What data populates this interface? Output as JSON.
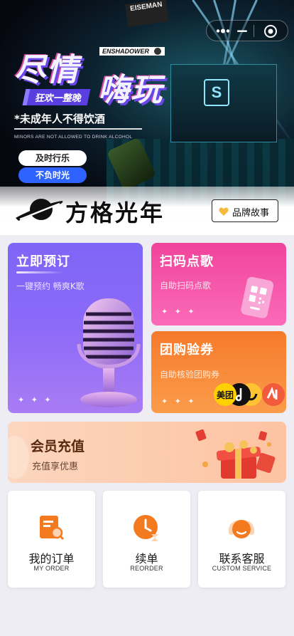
{
  "hero": {
    "title_line1": "尽情",
    "title_line2": "嗨玩",
    "brand_strip": "ENSHADOWER",
    "corner_tag": "EISEMAN",
    "tagline": "狂欢一整晚",
    "warning": "*未成年人不得饮酒",
    "warning_en": "MINORS ARE NOT ALLOWED TO DRINK ALCOHOL",
    "pill_1": "及时行乐",
    "pill_2": "不负时光"
  },
  "brand": {
    "name": "方格光年",
    "story_button": "品牌故事"
  },
  "cards": {
    "book": {
      "title": "立即预订",
      "subtitle": "一键预约 畅爽K歌",
      "sparks": "✦ ✦ ✦"
    },
    "scan": {
      "title": "扫码点歌",
      "subtitle": "自助扫码点歌",
      "sparks": "✦ ✦ ✦"
    },
    "group": {
      "title": "团购验券",
      "subtitle": "自助核验团购券",
      "sparks": "✦ ✦ ✦",
      "logo_text": "美团"
    },
    "member": {
      "title": "会员充值",
      "subtitle": "充值享优惠"
    }
  },
  "tiles": [
    {
      "label": "我的订单",
      "sub": "MY ORDER"
    },
    {
      "label": "续单",
      "sub": "REORDER"
    },
    {
      "label": "联系客服",
      "sub": "CUSTOM SERVICE"
    }
  ],
  "colors": {
    "book": "#7e65f6",
    "scan": "#f0449a",
    "group": "#f57a2a",
    "member": "#fdc3a2",
    "icon_orange": "#f47a1f"
  },
  "icons": [
    "more-icon",
    "minus-icon",
    "target-icon",
    "planet-logo-icon",
    "heart-icon",
    "microphone-icon",
    "qr-scan-icon",
    "platform-logos-icon",
    "gift-icon",
    "order-icon",
    "reorder-icon",
    "service-icon"
  ]
}
